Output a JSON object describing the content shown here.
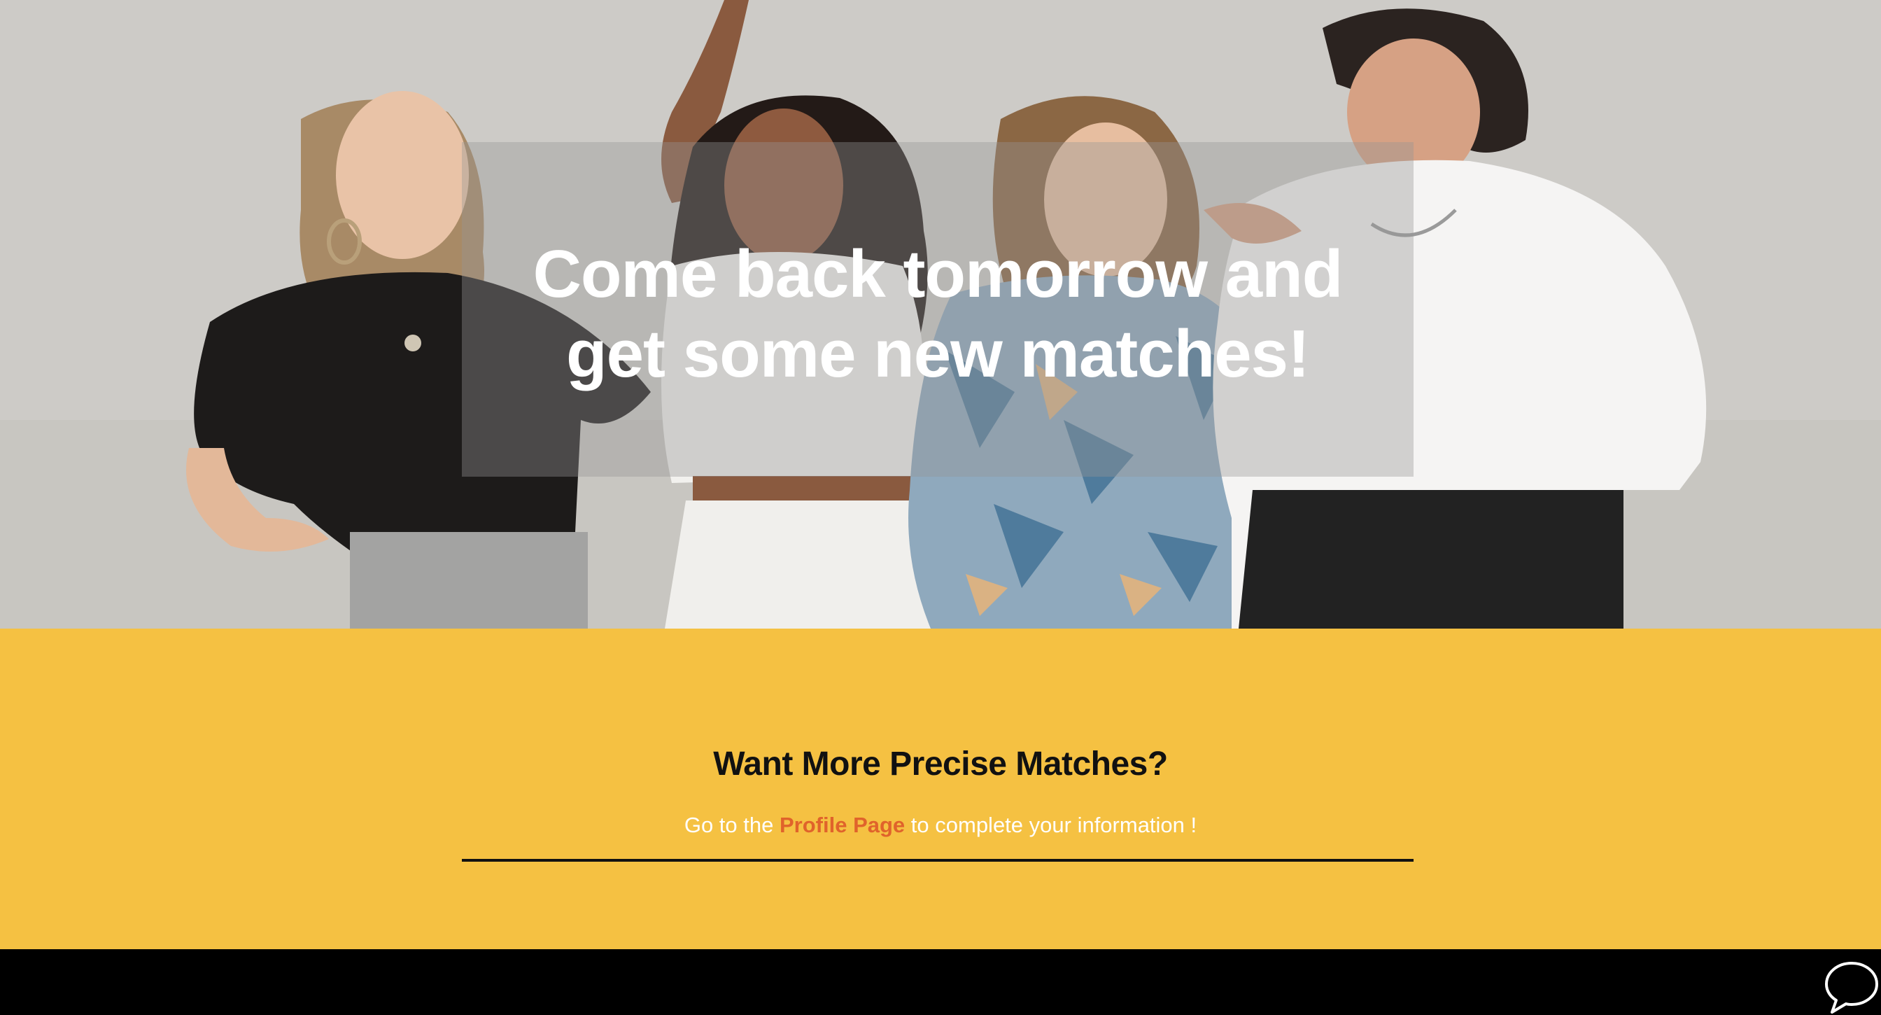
{
  "hero": {
    "headline_line1": "Come back tomorrow and",
    "headline_line2": "get some new matches!",
    "image_alt": "four-friends-laughing-photo"
  },
  "cta": {
    "title": "Want More Precise Matches?",
    "text_before": "Go to the ",
    "link_label": "Profile Page",
    "text_after": " to complete your information !"
  },
  "footer": {
    "chat_icon": "chat-bubble-icon"
  },
  "colors": {
    "cta_background": "#f5c142",
    "link": "#e0632b",
    "footer": "#000000"
  }
}
